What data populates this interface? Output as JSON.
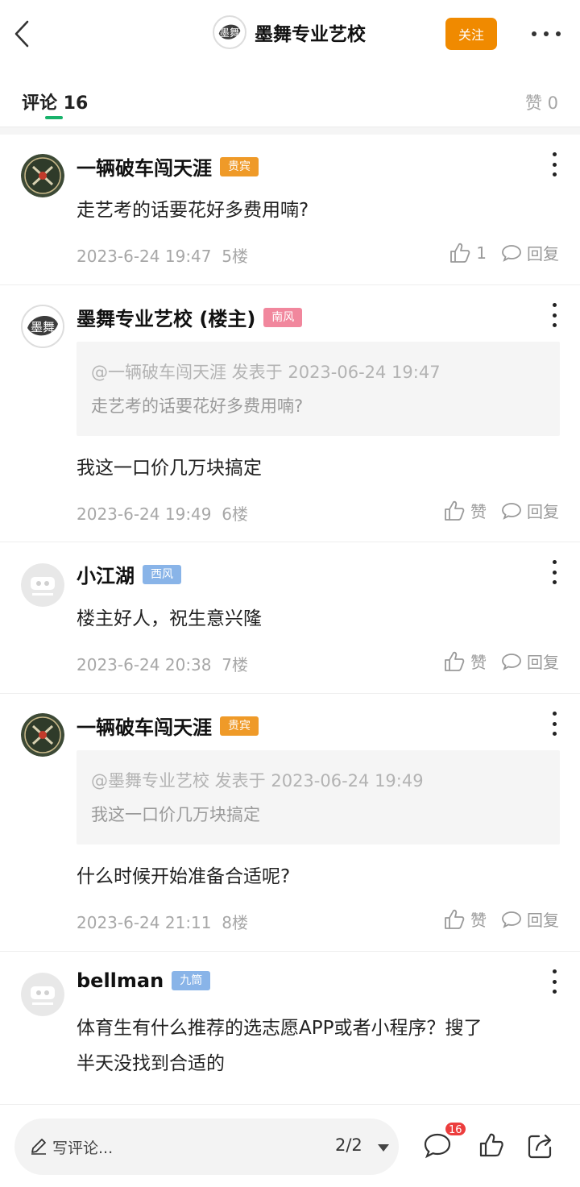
{
  "header": {
    "title": "墨舞专业艺校",
    "follow_label": "关注",
    "logo_text": "墨舞"
  },
  "tabs": {
    "comments_label": "评论 16",
    "likes_label": "赞 0"
  },
  "comments": [
    {
      "name": "一辆破车闯天涯",
      "badge": "贵宾",
      "text": "走艺考的话要花好多费用喃?",
      "time": "2023-6-24 19:47",
      "floor": "5楼",
      "like_label": "1",
      "reply_label": "回复"
    },
    {
      "name": "墨舞专业艺校 (楼主)",
      "badge": "南风",
      "quote_head": "@一辆破车闯天涯 发表于 2023-06-24 19:47",
      "quote_text": "走艺考的话要花好多费用喃?",
      "text": "我这一口价几万块搞定",
      "time": "2023-6-24 19:49",
      "floor": "6楼",
      "like_label": "赞",
      "reply_label": "回复"
    },
    {
      "name": "小江湖",
      "badge": "西风",
      "text": "楼主好人，祝生意兴隆",
      "time": "2023-6-24 20:38",
      "floor": "7楼",
      "like_label": "赞",
      "reply_label": "回复"
    },
    {
      "name": "一辆破车闯天涯",
      "badge": "贵宾",
      "quote_head": "@墨舞专业艺校 发表于 2023-06-24 19:49",
      "quote_text": "我这一口价几万块搞定",
      "text": "什么时候开始准备合适呢?",
      "time": "2023-6-24 21:11",
      "floor": "8楼",
      "like_label": "赞",
      "reply_label": "回复"
    },
    {
      "name": "bellman",
      "badge": "九筒",
      "text_line1": "体育生有什么推荐的选志愿APP或者小程序？搜了",
      "text_line2": "半天没找到合适的"
    }
  ],
  "bottom": {
    "write_placeholder": "写评论...",
    "pager": "2/2",
    "comment_count": "16"
  },
  "colors": {
    "accent_orange": "#f08a00",
    "tab_underline": "#18b26b",
    "badge_orange": "#ef9a28",
    "badge_pink": "#f1879d",
    "badge_blue": "#89b4e8",
    "notif_red": "#ec3d3d"
  },
  "icons": [
    "back-arrow-icon",
    "more-horizontal-icon",
    "more-vertical-icon",
    "thumbs-up-icon",
    "reply-bubble-icon",
    "pencil-icon",
    "comment-icon",
    "share-icon"
  ]
}
